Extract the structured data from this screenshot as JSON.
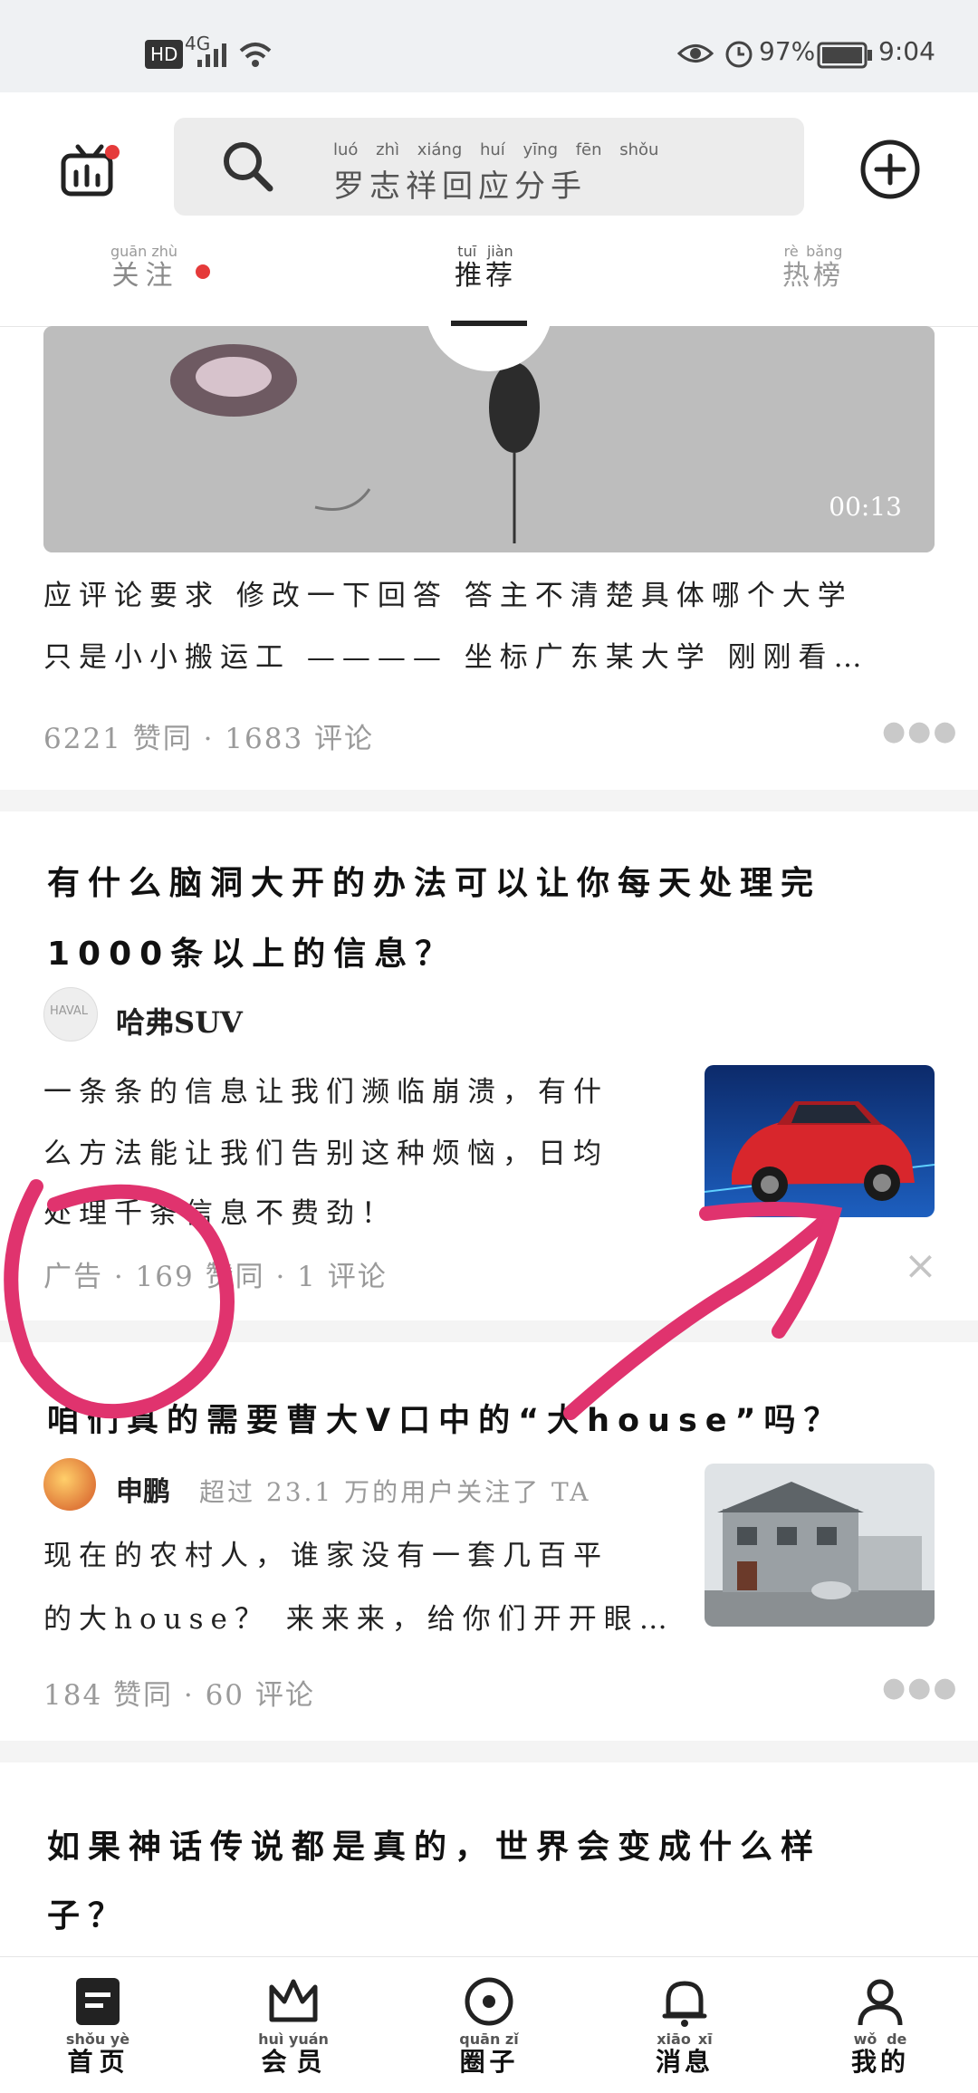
{
  "status_bar": {
    "network": "4G",
    "carrier": "HD",
    "wifi_label": "⌁",
    "battery": "97%",
    "time": "9:04"
  },
  "header": {
    "search_placeholder": "罗志祥回应分手",
    "search_pinyin": "luó zhì xiáng huí yīng fēn shǒu",
    "tabs": [
      {
        "label": "关注",
        "pinyin": "guān zhù"
      },
      {
        "label": "推荐",
        "pinyin": "tuī jiàn"
      },
      {
        "label": "热榜",
        "pinyin": "rè bǎng"
      }
    ]
  },
  "card1": {
    "video_duration": "00:13",
    "line1": "应评论要求 修改一下回答 答主不清楚具体哪个大学",
    "line2": "只是小小搬运工 ———— 坐标广东某大学 刚刚看…",
    "stats": "6221 赞同 · 1683 评论"
  },
  "card2": {
    "title_line1": "有什么脑洞大开的办法可以让你每天处理完",
    "title_line2": "1000条以上的信息？",
    "author": "哈弗SUV",
    "body_line1": "一条条的信息让我们濒临崩溃，有什",
    "body_line2": "么方法能让我们告别这种烦恼，日均",
    "body_line3": "处理千条信息不费劲！",
    "stats": "广告 · 169 赞同 · 1 评论",
    "close": "×",
    "logo_text": "HAVAL"
  },
  "card3": {
    "title": "咱们真的需要曹大V口中的“大house”吗？",
    "author": "申鹏",
    "author_note": "超过 23.1 万的用户关注了 TA",
    "body_line1": "现在的农村人，谁家没有一套几百平",
    "body_line2": "的大house？ 来来来，给你们开开眼…",
    "stats": "184 赞同 · 60 评论"
  },
  "card4": {
    "title_line1": "如果神话传说都是真的，世界会变成什么样",
    "title_line2": "子？"
  },
  "bottom_nav": [
    {
      "label": "首页",
      "pinyin": "shǒu yè",
      "icon": "home-icon"
    },
    {
      "label": "会员",
      "pinyin": "huì yuán",
      "icon": "crown-icon"
    },
    {
      "label": "圈子",
      "pinyin": "quān zǐ",
      "icon": "circle-icon"
    },
    {
      "label": "消息",
      "pinyin": "xiāo xī",
      "icon": "bell-icon"
    },
    {
      "label": "我的",
      "pinyin": "wǒ de",
      "icon": "profile-icon"
    }
  ],
  "colors": {
    "accent_red": "#e53a3a",
    "annotation_pink": "#e0336e",
    "tab_active": "#222222"
  }
}
